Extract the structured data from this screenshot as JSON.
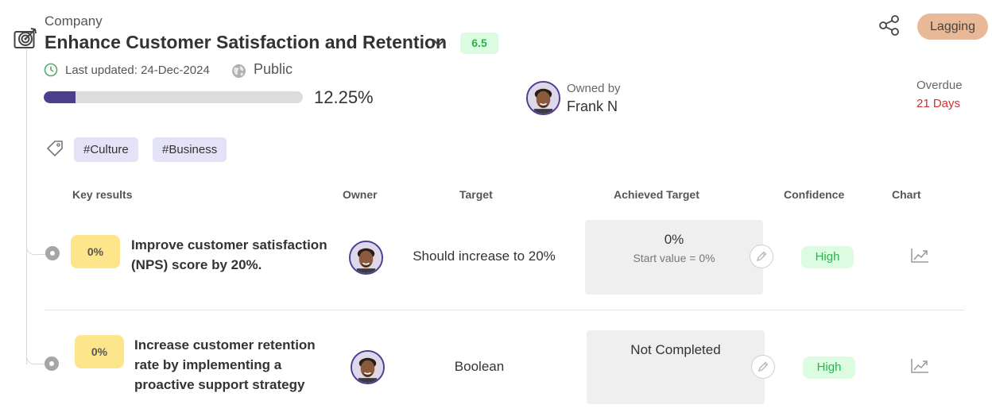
{
  "objective": {
    "level": "Company",
    "title": "Enhance Customer Satisfaction and Retention",
    "score": "6.5",
    "status": "Lagging",
    "last_updated": "Last updated: 24-Dec-2024",
    "visibility": "Public",
    "progress_value": 12.25,
    "progress_text": "12.25%",
    "owner_label": "Owned by",
    "owner_name": "Frank N",
    "overdue_label": "Overdue",
    "overdue_value": "21 Days",
    "tags": [
      "#Culture",
      "#Business"
    ]
  },
  "table": {
    "headers": {
      "key_results": "Key results",
      "owner": "Owner",
      "target": "Target",
      "achieved": "Achieved Target",
      "confidence": "Confidence",
      "chart": "Chart"
    },
    "rows": [
      {
        "progress": "0%",
        "title_line1": "Improve customer satisfaction",
        "title_line2": "(NPS) score by 20%.",
        "target": "Should increase to 20%",
        "achieved_main": "0%",
        "achieved_sub": "Start value = 0%",
        "confidence": "High"
      },
      {
        "progress": "0%",
        "title_line1": "Increase customer retention",
        "title_line2": "rate by implementing a",
        "title_line3": "proactive support strategy",
        "target": "Boolean",
        "achieved_main": "Not Completed",
        "confidence": "High"
      }
    ]
  },
  "colors": {
    "progress_fill": "#4c3d8f",
    "progress_track": "#dcdcdc",
    "status_badge": "#e9b896",
    "score_badge": "#dcfce1",
    "overdue": "#d32f2f",
    "tag_bg": "#e4e2f7",
    "kr_progress_bg": "#fde58c"
  },
  "icons": [
    "target-icon",
    "chevron-down-icon",
    "clock-icon",
    "globe-icon",
    "share-icon",
    "tag-icon",
    "edit-icon",
    "trend-chart-icon"
  ]
}
